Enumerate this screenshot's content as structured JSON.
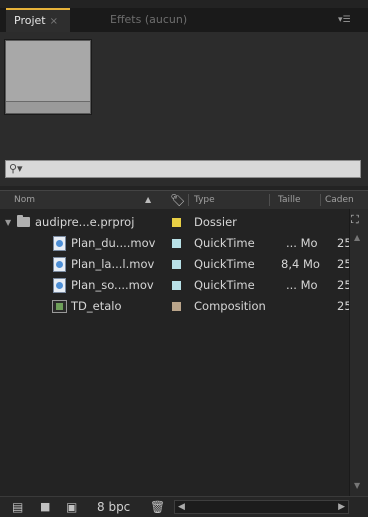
{
  "tabs": {
    "project": {
      "label": "Projet",
      "close": "×"
    },
    "effects": {
      "label": "Effets (aucun)"
    },
    "menu_glyph": "▾☰"
  },
  "search": {
    "icon": "magnifier-icon",
    "value": "",
    "glyph": "⚲▾"
  },
  "columns": {
    "name": "Nom",
    "label_icon": "tag-icon",
    "type": "Type",
    "size": "Taille",
    "framerate": "Caden"
  },
  "items": [
    {
      "name": "audipre...e.prproj",
      "type": "Dossier",
      "size": "",
      "framerate": "",
      "kind": "folder",
      "label_color": "#e8cf45",
      "expanded": true
    },
    {
      "name": "Plan_du....mov",
      "type": "QuickTime",
      "size": "... Mo",
      "framerate": "25",
      "kind": "footage",
      "label_color": "#b8e0e6"
    },
    {
      "name": "Plan_la...l.mov",
      "type": "QuickTime",
      "size": "8,4 Mo",
      "framerate": "25",
      "kind": "footage",
      "label_color": "#b8e0e6"
    },
    {
      "name": "Plan_so....mov",
      "type": "QuickTime",
      "size": "... Mo",
      "framerate": "25",
      "kind": "footage",
      "label_color": "#b8e0e6"
    },
    {
      "name": "TD_etalo",
      "type": "Composition",
      "size": "",
      "framerate": "25",
      "kind": "composition",
      "label_color": "#b9a48a"
    }
  ],
  "bottom": {
    "bpc_label": "8 bpc"
  },
  "colors": {
    "accent": "#e7b33a",
    "panel_bg": "#232323"
  }
}
